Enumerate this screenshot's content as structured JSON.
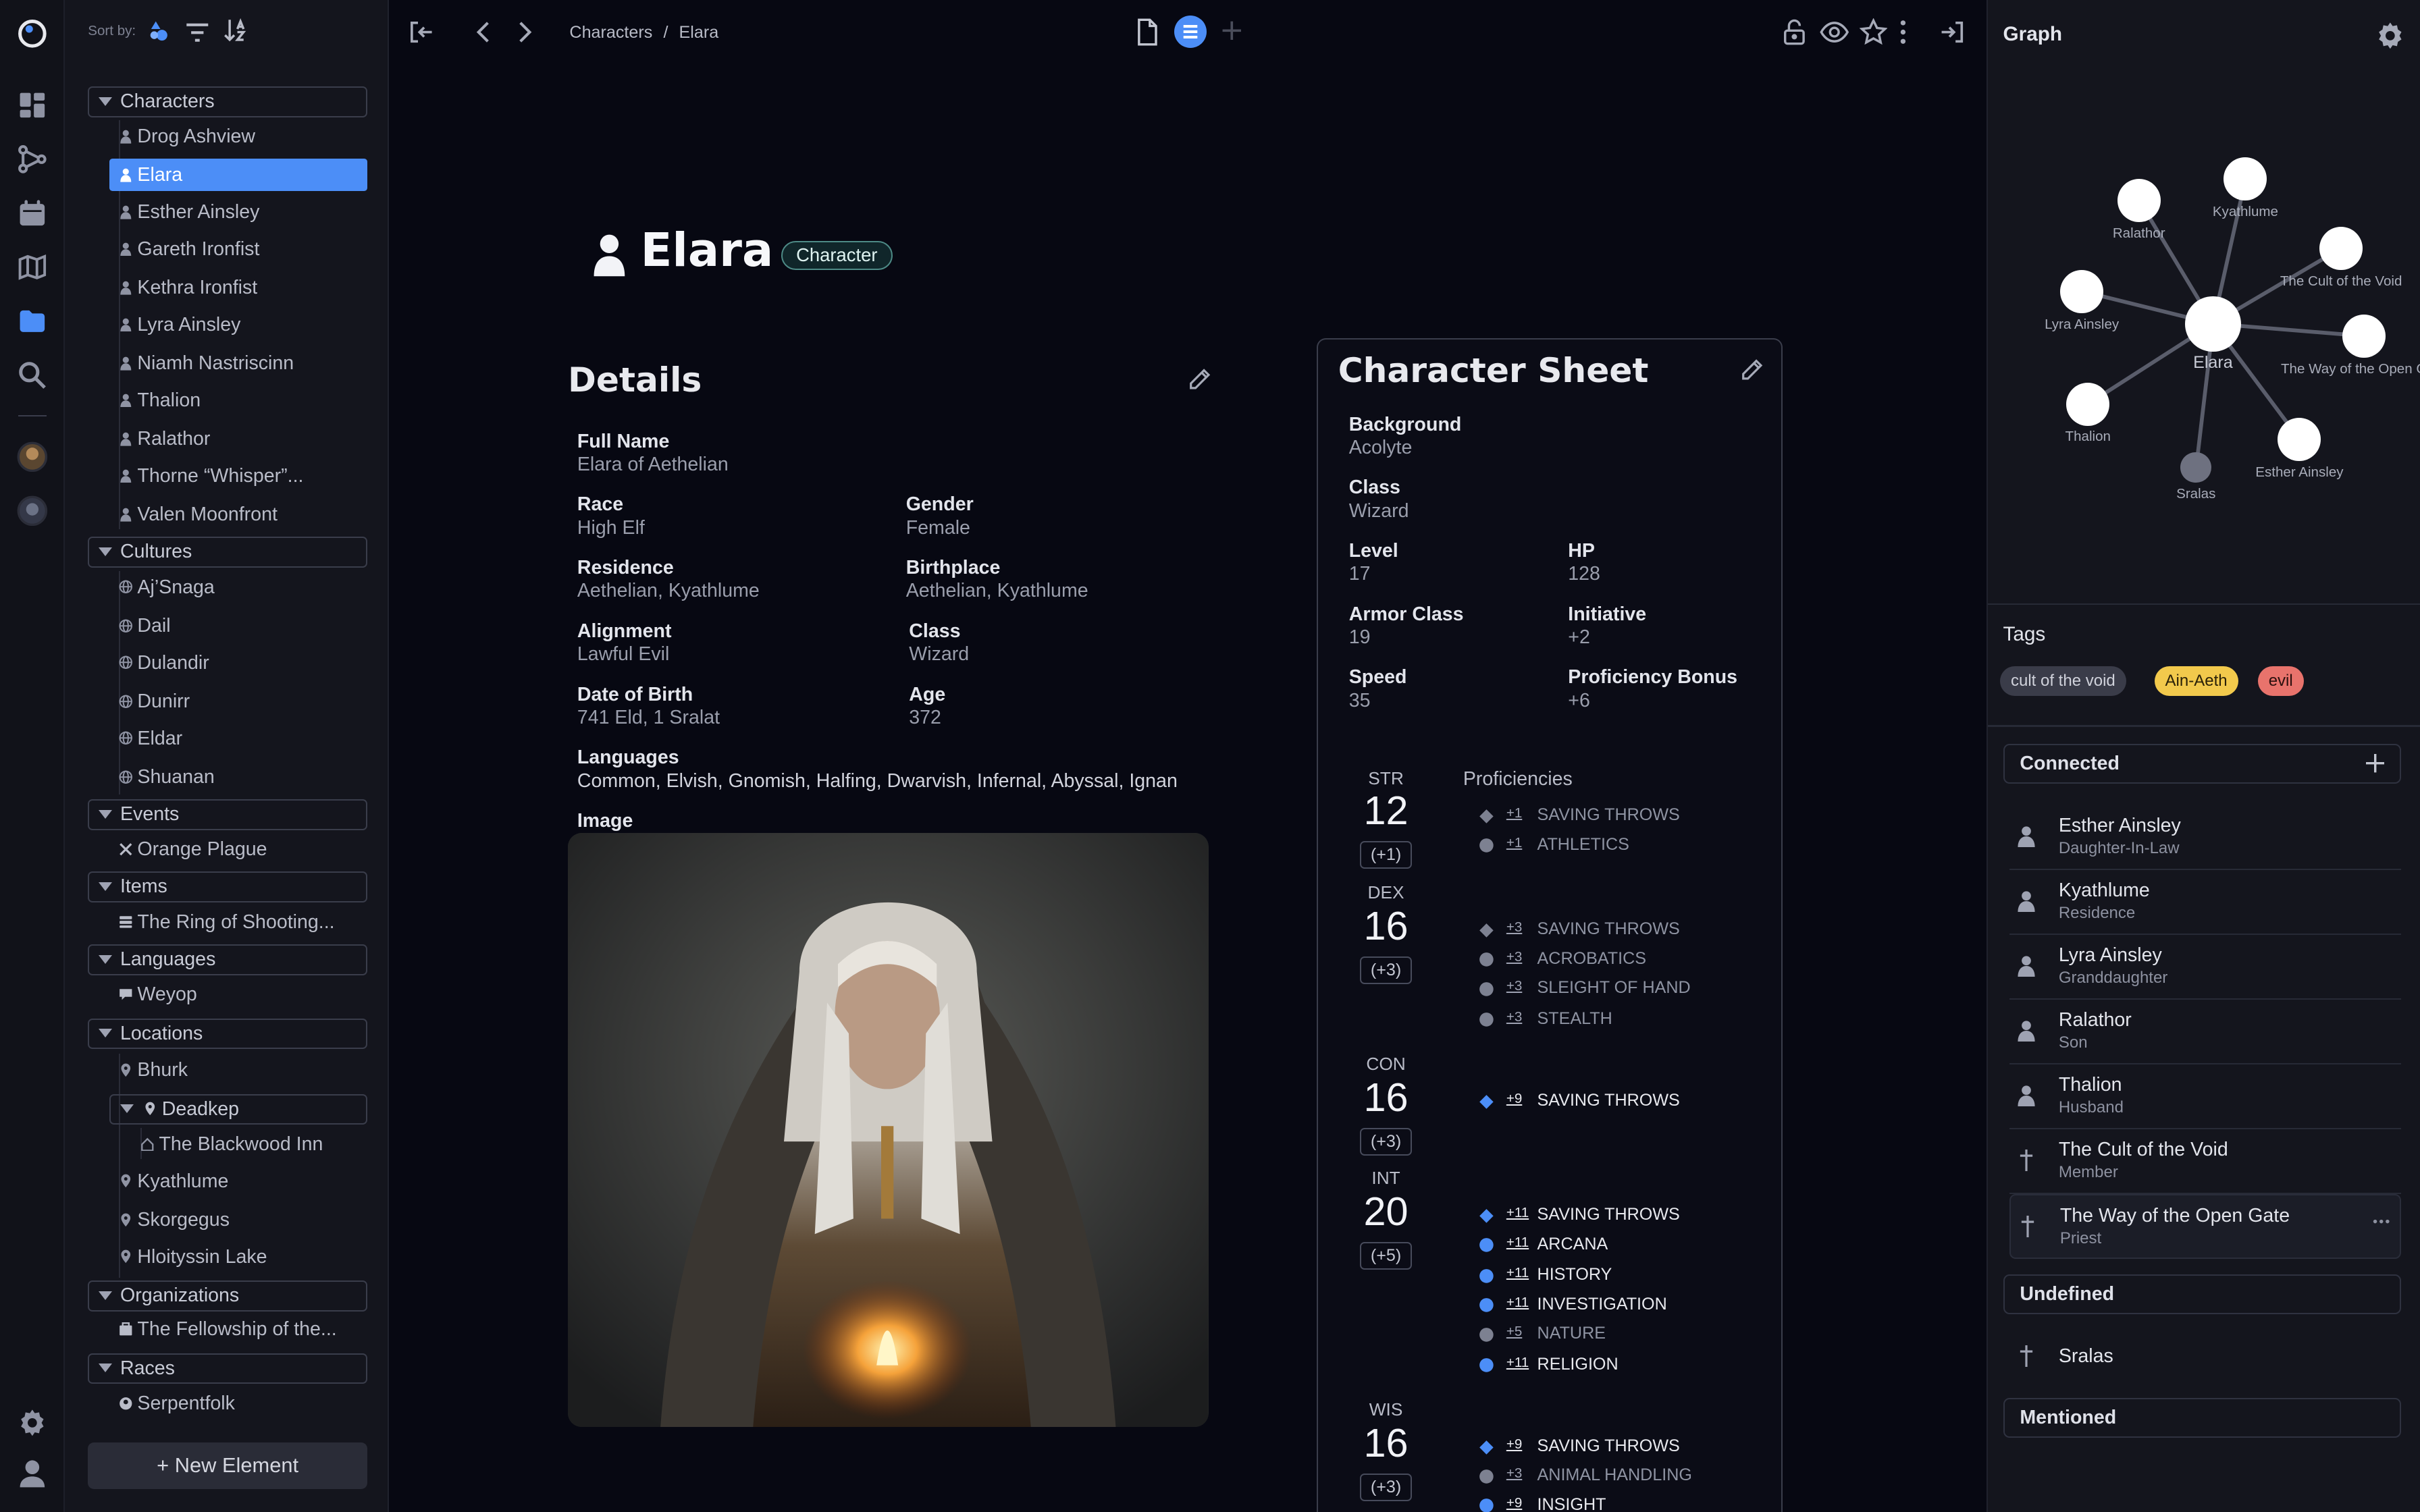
{
  "sidebar": {
    "sort_label": "Sort by:",
    "groups": {
      "characters": "Characters",
      "cultures": "Cultures",
      "events": "Events",
      "items": "Items",
      "languages": "Languages",
      "locations": "Locations",
      "organizations": "Organizations",
      "races": "Races"
    },
    "characters": [
      "Drog Ashview",
      "Elara",
      "Esther Ainsley",
      "Gareth Ironfist",
      "Kethra Ironfist",
      "Lyra Ainsley",
      "Niamh Nastriscinn",
      "Thalion",
      "Ralathor",
      "Thorne “Whisper”...",
      "Valen Moonfront"
    ],
    "cultures": [
      "Aj’Snaga",
      "Dail",
      "Dulandir",
      "Dunirr",
      "Eldar",
      "Shuanan"
    ],
    "events": [
      "Orange Plague"
    ],
    "items": [
      "The Ring of Shooting..."
    ],
    "languages": [
      "Weyop"
    ],
    "locations": [
      "Bhurk",
      "Deadkep",
      "The Blackwood Inn",
      "Kyathlume",
      "Skorgegus",
      "Hloityssin Lake"
    ],
    "organizations": [
      "The Fellowship of the..."
    ],
    "races": [
      "Serpentfolk"
    ],
    "new_element": "+ New Element"
  },
  "topbar": {
    "breadcrumb_root": "Characters",
    "breadcrumb_sep": "/",
    "breadcrumb_current": "Elara"
  },
  "page": {
    "title": "Elara",
    "type_badge": "Character"
  },
  "details": {
    "heading": "Details",
    "full_name_label": "Full Name",
    "full_name": "Elara of Aethelian",
    "race_label": "Race",
    "race": "High Elf",
    "gender_label": "Gender",
    "gender": "Female",
    "residence_label": "Residence",
    "residence": "Aethelian, Kyathlume",
    "birthplace_label": "Birthplace",
    "birthplace": "Aethelian, Kyathlume",
    "alignment_label": "Alignment",
    "alignment": "Lawful Evil",
    "class_label": "Class",
    "class": "Wizard",
    "dob_label": "Date of Birth",
    "dob": "741 Eld, 1 Sralat",
    "age_label": "Age",
    "age": "372",
    "languages_label": "Languages",
    "languages": "Common, Elvish, Gnomish, Halfing, Dwarvish, Infernal, Abyssal, Ignan",
    "image_label": "Image"
  },
  "sheet": {
    "heading": "Character Sheet",
    "background_label": "Background",
    "background": "Acolyte",
    "class_label": "Class",
    "class": "Wizard",
    "level_label": "Level",
    "level": "17",
    "hp_label": "HP",
    "hp": "128",
    "ac_label": "Armor Class",
    "ac": "19",
    "initiative_label": "Initiative",
    "initiative": "+2",
    "speed_label": "Speed",
    "speed": "35",
    "prof_bonus_label": "Proficiency Bonus",
    "prof_bonus": "+6",
    "proficiencies_label": "Proficiencies",
    "stats": [
      {
        "label": "STR",
        "value": "12",
        "mod": "(+1)"
      },
      {
        "label": "DEX",
        "value": "16",
        "mod": "(+3)"
      },
      {
        "label": "CON",
        "value": "16",
        "mod": "(+3)"
      },
      {
        "label": "INT",
        "value": "20",
        "mod": "(+5)"
      },
      {
        "label": "WIS",
        "value": "16",
        "mod": "(+3)"
      }
    ],
    "skills": [
      {
        "bonus": "+1",
        "name": "SAVING THROWS"
      },
      {
        "bonus": "+1",
        "name": "ATHLETICS"
      },
      {
        "bonus": "+3",
        "name": "SAVING THROWS"
      },
      {
        "bonus": "+3",
        "name": "ACROBATICS"
      },
      {
        "bonus": "+3",
        "name": "SLEIGHT OF HAND"
      },
      {
        "bonus": "+3",
        "name": "STEALTH"
      },
      {
        "bonus": "+9",
        "name": "SAVING THROWS"
      },
      {
        "bonus": "+11",
        "name": "SAVING THROWS"
      },
      {
        "bonus": "+11",
        "name": "ARCANA"
      },
      {
        "bonus": "+11",
        "name": "HISTORY"
      },
      {
        "bonus": "+11",
        "name": "INVESTIGATION"
      },
      {
        "bonus": "+5",
        "name": "NATURE"
      },
      {
        "bonus": "+11",
        "name": "RELIGION"
      },
      {
        "bonus": "+9",
        "name": "SAVING THROWS"
      },
      {
        "bonus": "+3",
        "name": "ANIMAL HANDLING"
      },
      {
        "bonus": "+9",
        "name": "INSIGHT"
      }
    ]
  },
  "right_panel": {
    "graph_title": "Graph",
    "graph_nodes": {
      "center": "Elara",
      "ralathor": "Ralathor",
      "kyathlume": "Kyathlume",
      "cult": "The Cult of the Void",
      "lyra": "Lyra Ainsley",
      "way": "The Way of the Open G",
      "thalion": "Thalion",
      "esther": "Esther Ainsley",
      "sralas": "Sralas"
    },
    "tags_title": "Tags",
    "tags": [
      "cult of the void",
      "Ain-Aeth",
      "evil"
    ],
    "tag_colors": [
      "#3a3c49",
      "#f2c94c",
      "#e8736c"
    ],
    "connected_title": "Connected",
    "connected": [
      {
        "name": "Esther Ainsley",
        "role": "Daughter-In-Law"
      },
      {
        "name": "Kyathlume",
        "role": "Residence"
      },
      {
        "name": "Lyra Ainsley",
        "role": "Granddaughter"
      },
      {
        "name": "Ralathor",
        "role": "Son"
      },
      {
        "name": "Thalion",
        "role": "Husband"
      },
      {
        "name": "The Cult of the Void",
        "role": "Member"
      },
      {
        "name": "The Way of the Open Gate",
        "role": "Priest"
      }
    ],
    "undefined_title": "Undefined",
    "undefined": [
      {
        "name": "Sralas"
      }
    ],
    "mentioned_title": "Mentioned"
  }
}
